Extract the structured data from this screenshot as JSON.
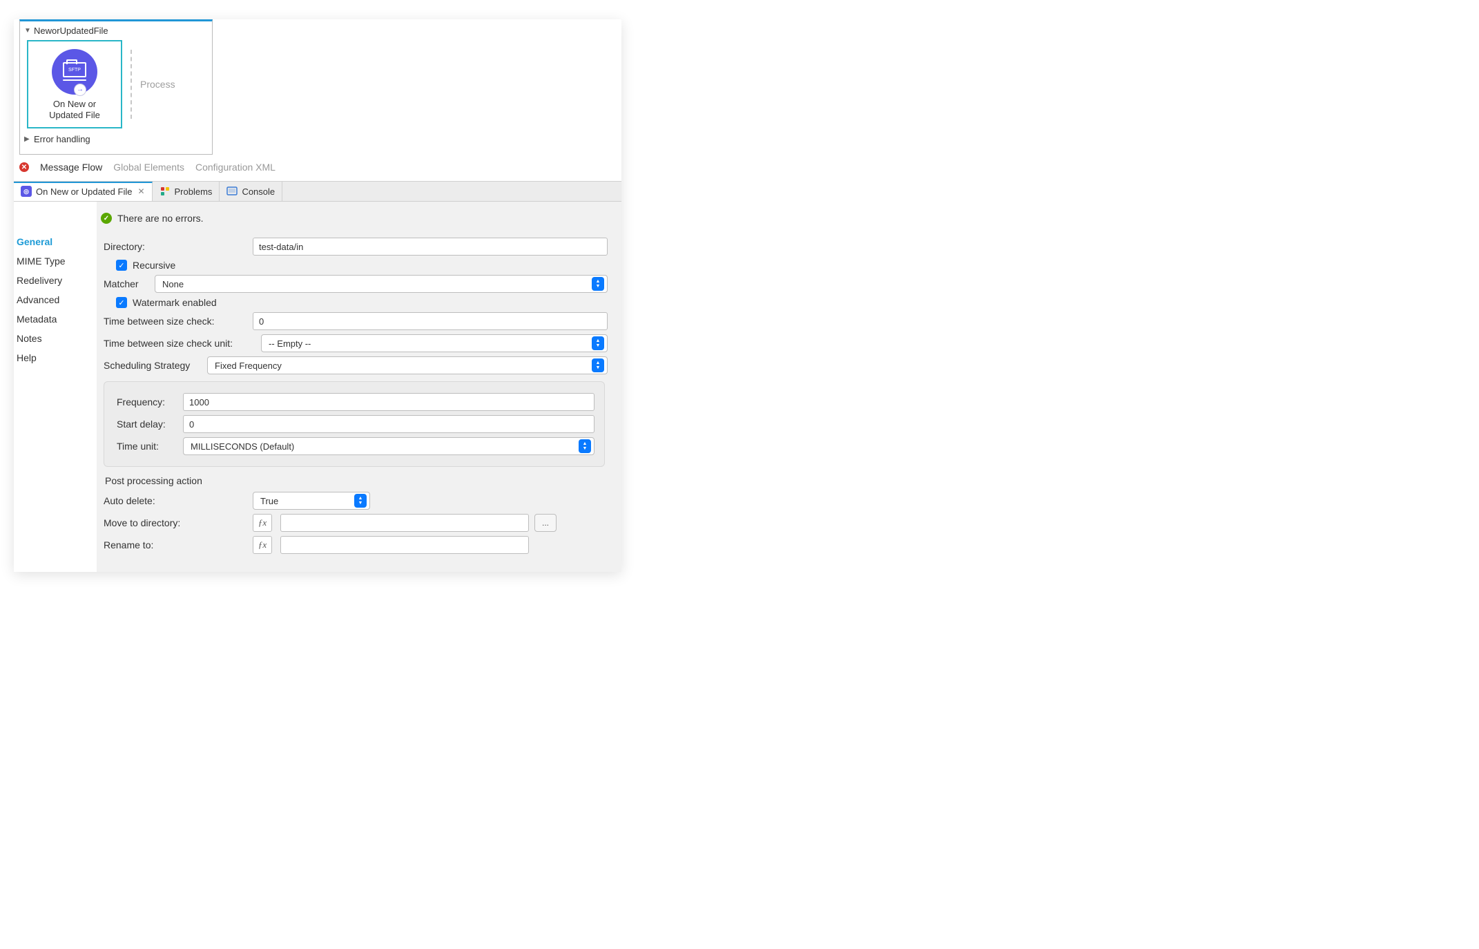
{
  "flow": {
    "name": "NeworUpdatedFile",
    "node_label_line1": "On New or",
    "node_label_line2": "Updated File",
    "sftp_badge": "SFTP",
    "process_placeholder": "Process",
    "error_handling": "Error handling"
  },
  "editor_tabs": {
    "message_flow": "Message Flow",
    "global_elements": "Global Elements",
    "config_xml": "Configuration XML"
  },
  "view_tabs": {
    "primary": "On New or Updated File",
    "problems": "Problems",
    "console": "Console"
  },
  "status": "There are no errors.",
  "sidebar": {
    "general": "General",
    "mime": "MIME Type",
    "redelivery": "Redelivery",
    "advanced": "Advanced",
    "metadata": "Metadata",
    "notes": "Notes",
    "help": "Help"
  },
  "form": {
    "directory_label": "Directory:",
    "directory_value": "test-data/in",
    "recursive_label": "Recursive",
    "matcher_label": "Matcher",
    "matcher_value": "None",
    "watermark_label": "Watermark enabled",
    "tbsc_label": "Time between size check:",
    "tbsc_value": "0",
    "tbsc_unit_label": "Time between size check unit:",
    "tbsc_unit_value": "-- Empty --",
    "sched_label": "Scheduling Strategy",
    "sched_value": "Fixed Frequency",
    "freq_label": "Frequency:",
    "freq_value": "1000",
    "start_delay_label": "Start delay:",
    "start_delay_value": "0",
    "time_unit_label": "Time unit:",
    "time_unit_value": "MILLISECONDS (Default)",
    "post_title": "Post processing action",
    "auto_delete_label": "Auto delete:",
    "auto_delete_value": "True",
    "moveto_label": "Move to directory:",
    "rename_label": "Rename to:",
    "browse": "..."
  }
}
